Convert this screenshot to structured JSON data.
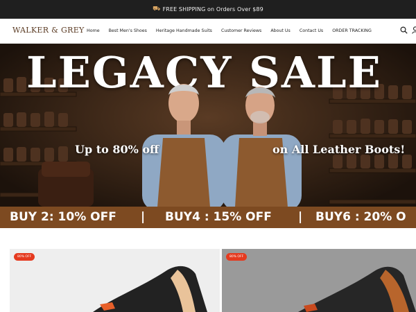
{
  "announcement": {
    "icon": "truck-icon",
    "text": "FREE SHIPPING on Orders Over $89"
  },
  "header": {
    "logo": "WALKER & GREY",
    "menu": [
      "Home",
      "Best Men's Shoes",
      "Heritage Handmade Suits",
      "Customer Reviews",
      "About Us",
      "Contact Us",
      "ORDER TRACKING"
    ],
    "icons": [
      "search-icon",
      "account-icon"
    ]
  },
  "hero": {
    "title": "LEGACY SALE",
    "subtitle_left": "Up to 80% off",
    "subtitle_right": "on All Leather Boots!",
    "promo": [
      "BUY 2: 10% OFF",
      "|",
      "BUY4 : 15% OFF",
      "|",
      "BUY6 : 20% O"
    ]
  },
  "products": [
    {
      "badge": "80% OFF"
    },
    {
      "badge": "80% OFF"
    }
  ],
  "colors": {
    "accent_brown": "#7d4a21",
    "badge_red": "#e53a1f",
    "announce_bg": "#1f1f1f"
  }
}
